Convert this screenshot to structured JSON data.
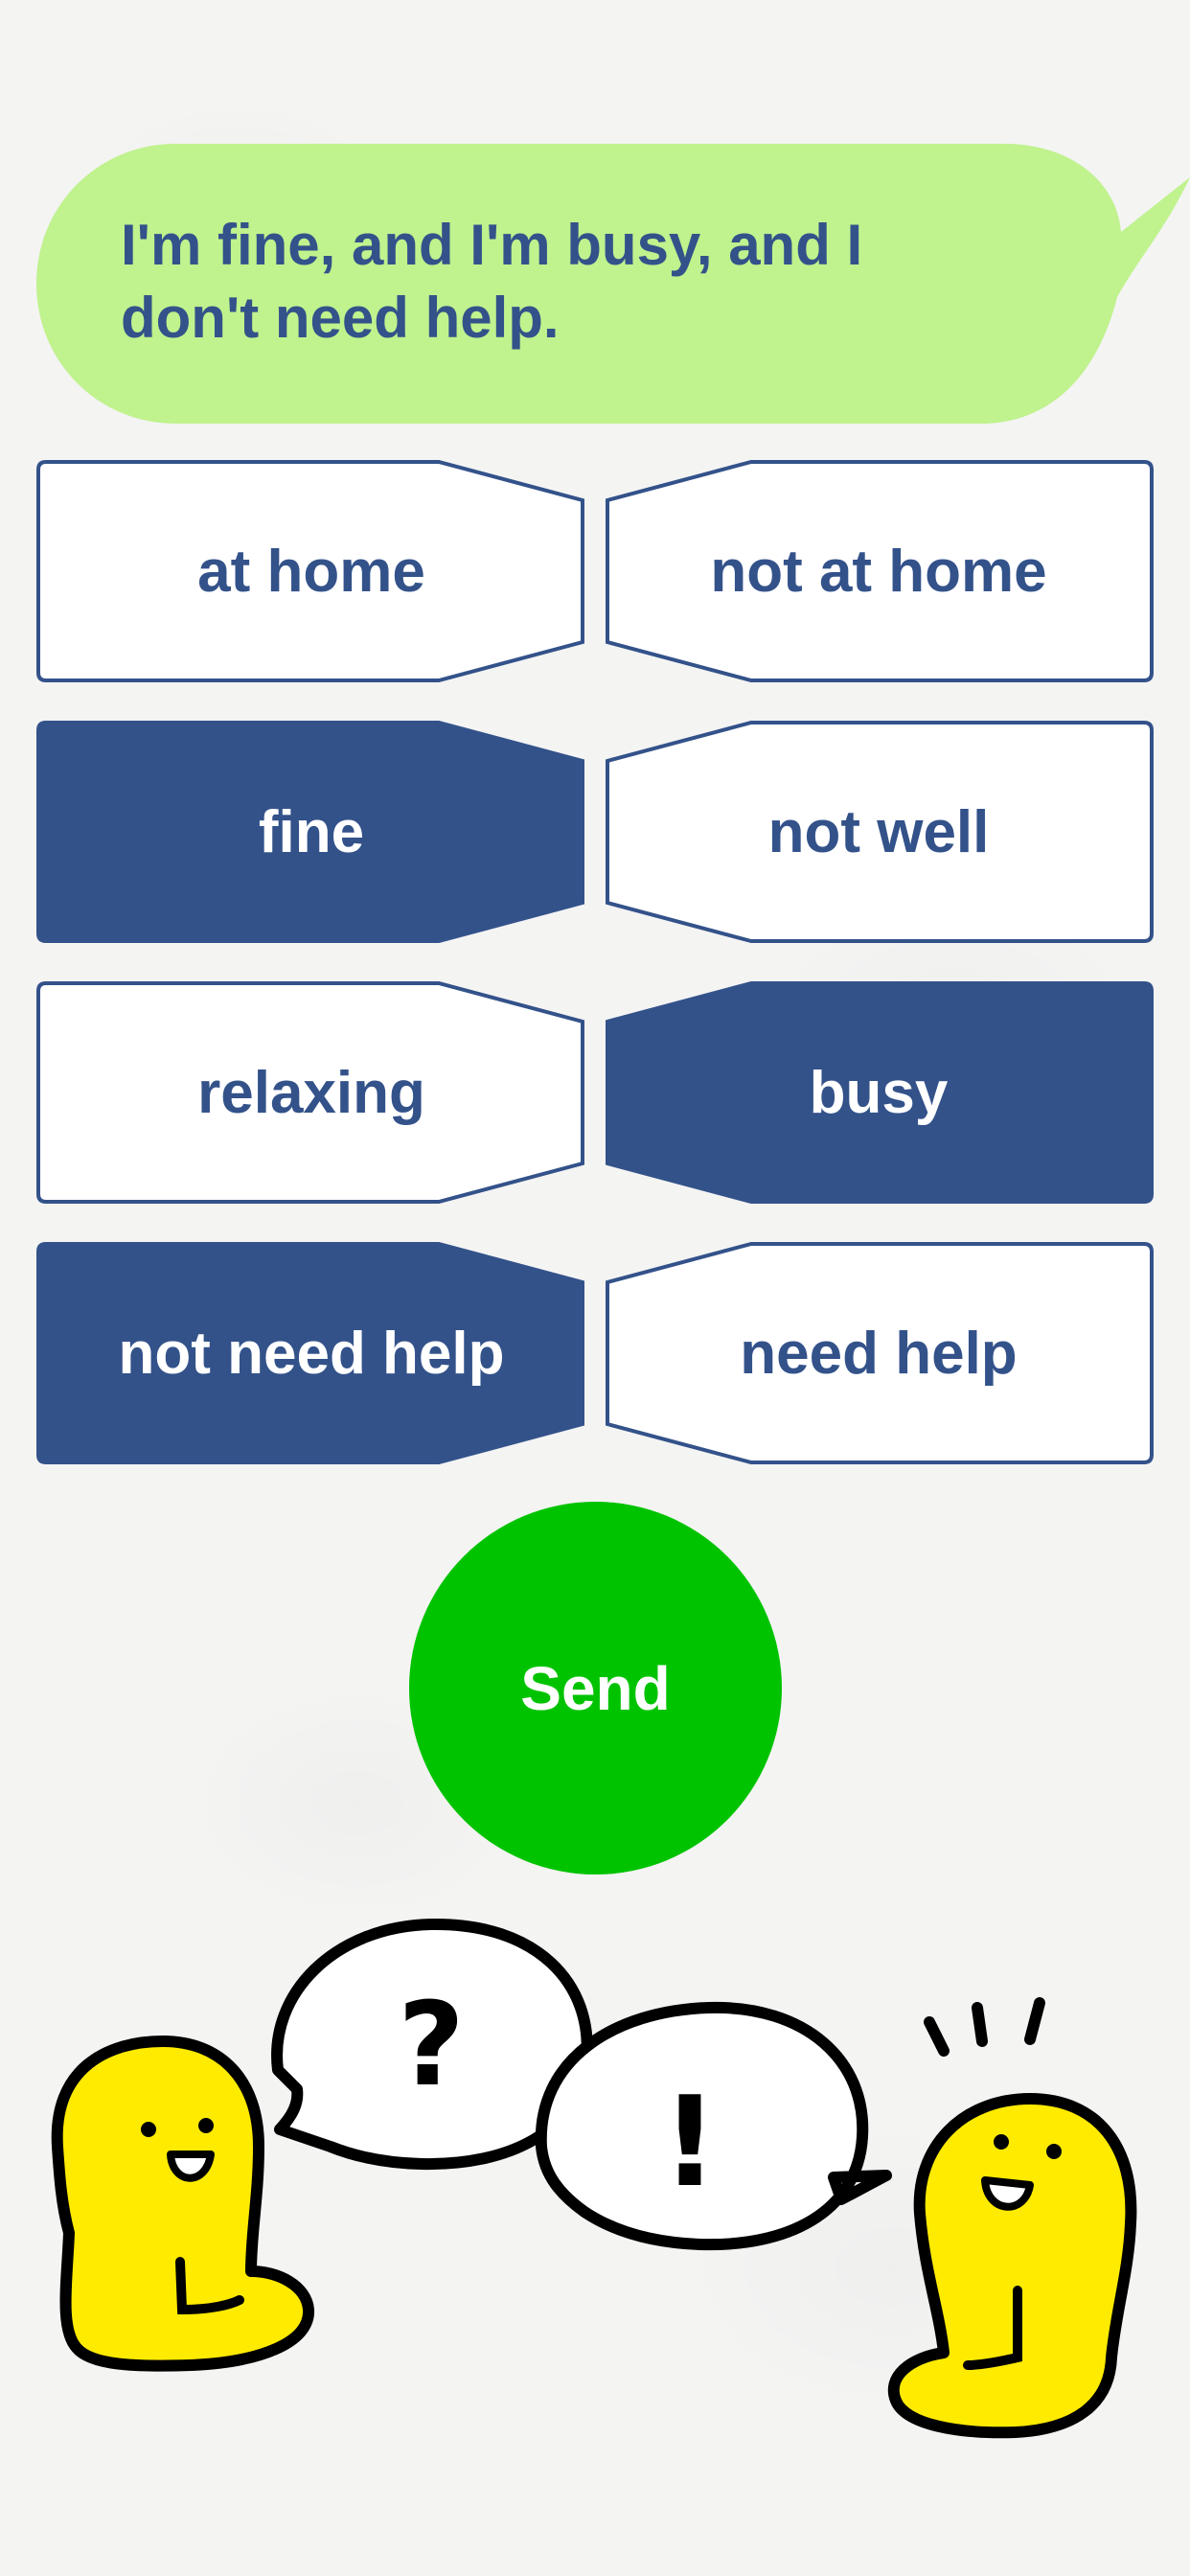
{
  "message": {
    "text": "I'm fine, and I'm busy, and I don't need help."
  },
  "options": [
    {
      "label": "at home",
      "selected": false
    },
    {
      "label": "not at home",
      "selected": false
    },
    {
      "label": "fine",
      "selected": true
    },
    {
      "label": "not well",
      "selected": false
    },
    {
      "label": "relaxing",
      "selected": false
    },
    {
      "label": "busy",
      "selected": true
    },
    {
      "label": "not need help",
      "selected": true
    },
    {
      "label": "need help",
      "selected": false
    }
  ],
  "send_button": {
    "label": "Send"
  },
  "illustration": {
    "left_bubble_symbol": "?",
    "right_bubble_symbol": "!"
  },
  "colors": {
    "accent": "#33528a",
    "bubble": "#c0f28e",
    "send": "#00c300",
    "character": "#ffeb00"
  }
}
